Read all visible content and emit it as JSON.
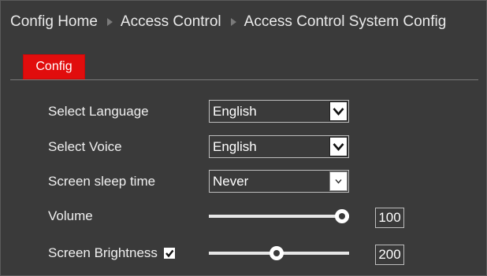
{
  "breadcrumb": {
    "items": [
      "Config Home",
      "Access Control",
      "Access Control System Config"
    ]
  },
  "tabs": [
    {
      "label": "Config",
      "active": true
    }
  ],
  "form": {
    "language": {
      "label": "Select Language",
      "value": "English"
    },
    "voice": {
      "label": "Select Voice",
      "value": "English"
    },
    "sleep": {
      "label": "Screen sleep time",
      "value": "Never"
    },
    "volume": {
      "label": "Volume",
      "value": "100",
      "level": 1.0
    },
    "brightness": {
      "label": "Screen Brightness",
      "checked": true,
      "value": "200",
      "level": 0.48
    }
  },
  "colors": {
    "background": "#3a3a3a",
    "accent_tab": "#e10d0d",
    "text": "#f0f0f0"
  }
}
